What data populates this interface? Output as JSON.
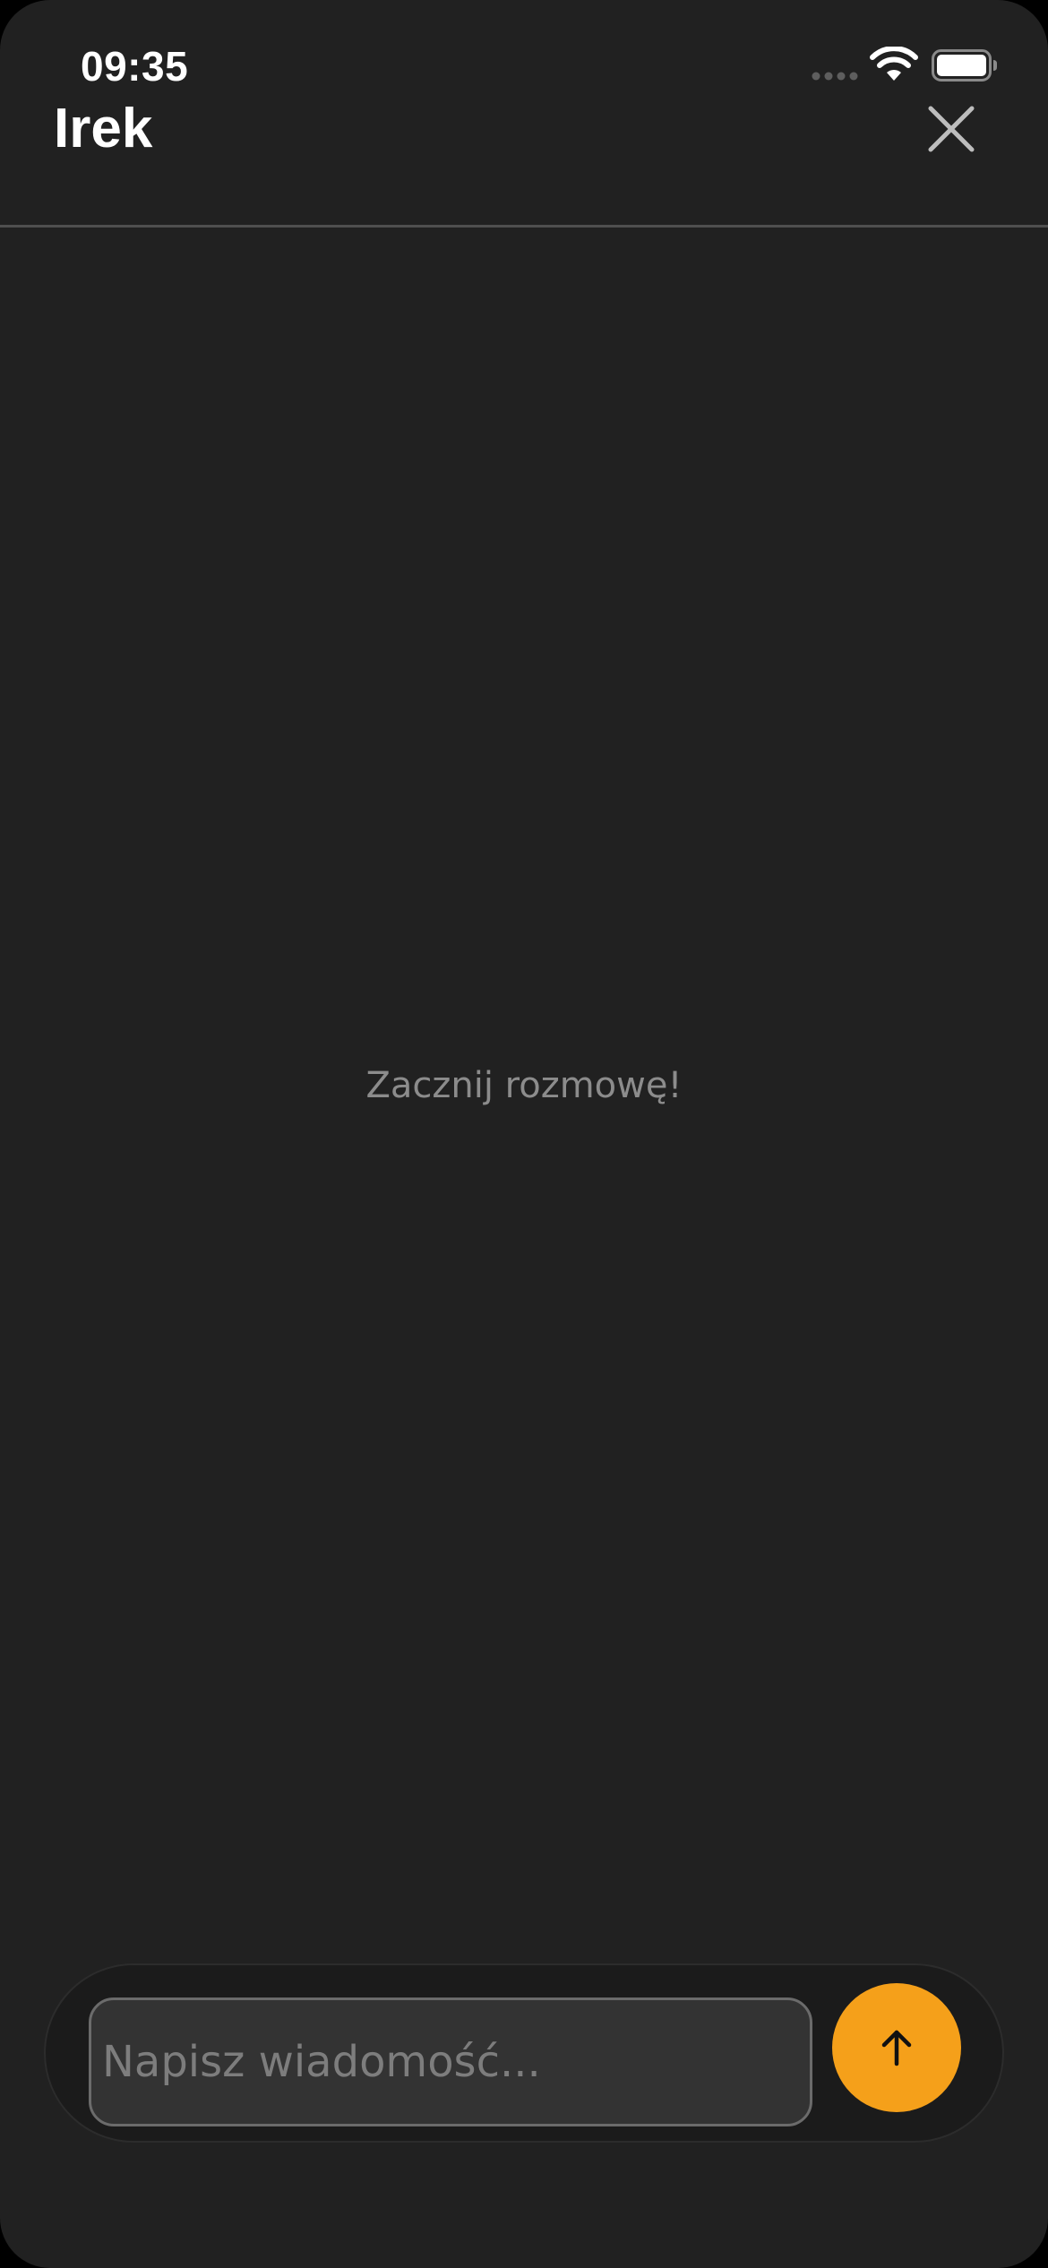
{
  "status_bar": {
    "time": "09:35"
  },
  "header": {
    "title": "Irek",
    "close_icon": "close-icon"
  },
  "chat": {
    "empty_message": "Zacznij rozmowę!"
  },
  "composer": {
    "placeholder": "Napisz wiadomość...",
    "value": "",
    "send_icon": "arrow-up-icon"
  },
  "colors": {
    "background": "#212121",
    "accent": "#f5a01a",
    "divider": "#4f4f4f",
    "input_background": "#333333"
  }
}
